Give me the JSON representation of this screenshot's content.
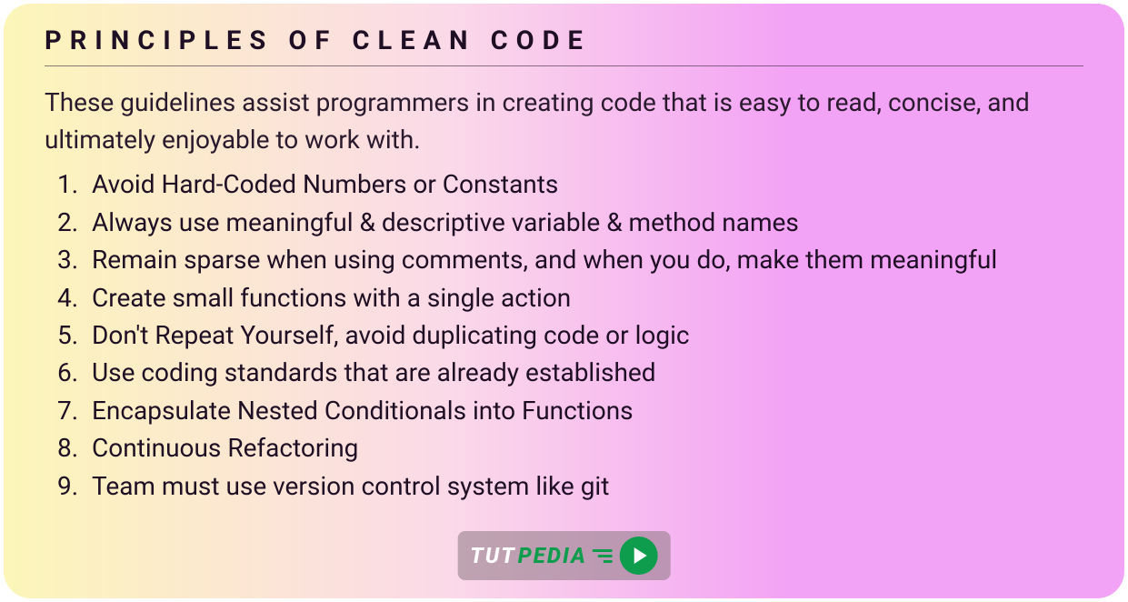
{
  "title": "PRINCIPLES OF CLEAN CODE",
  "intro": "These guidelines assist programmers in creating code that is easy to read, concise, and ultimately enjoyable to work with.",
  "principles": [
    "Avoid Hard-Coded Numbers or Constants",
    "Always use meaningful & descriptive variable & method names",
    "Remain sparse when using comments, and when you do, make them meaningful",
    "Create small functions with a single action",
    "Don't Repeat Yourself, avoid duplicating code or logic",
    "Use coding standards that are already established",
    "Encapsulate Nested Conditionals into Functions",
    "Continuous Refactoring",
    "Team must use version control system like git"
  ],
  "watermark": {
    "text_white": "TUT",
    "text_green": "PEDIA"
  }
}
